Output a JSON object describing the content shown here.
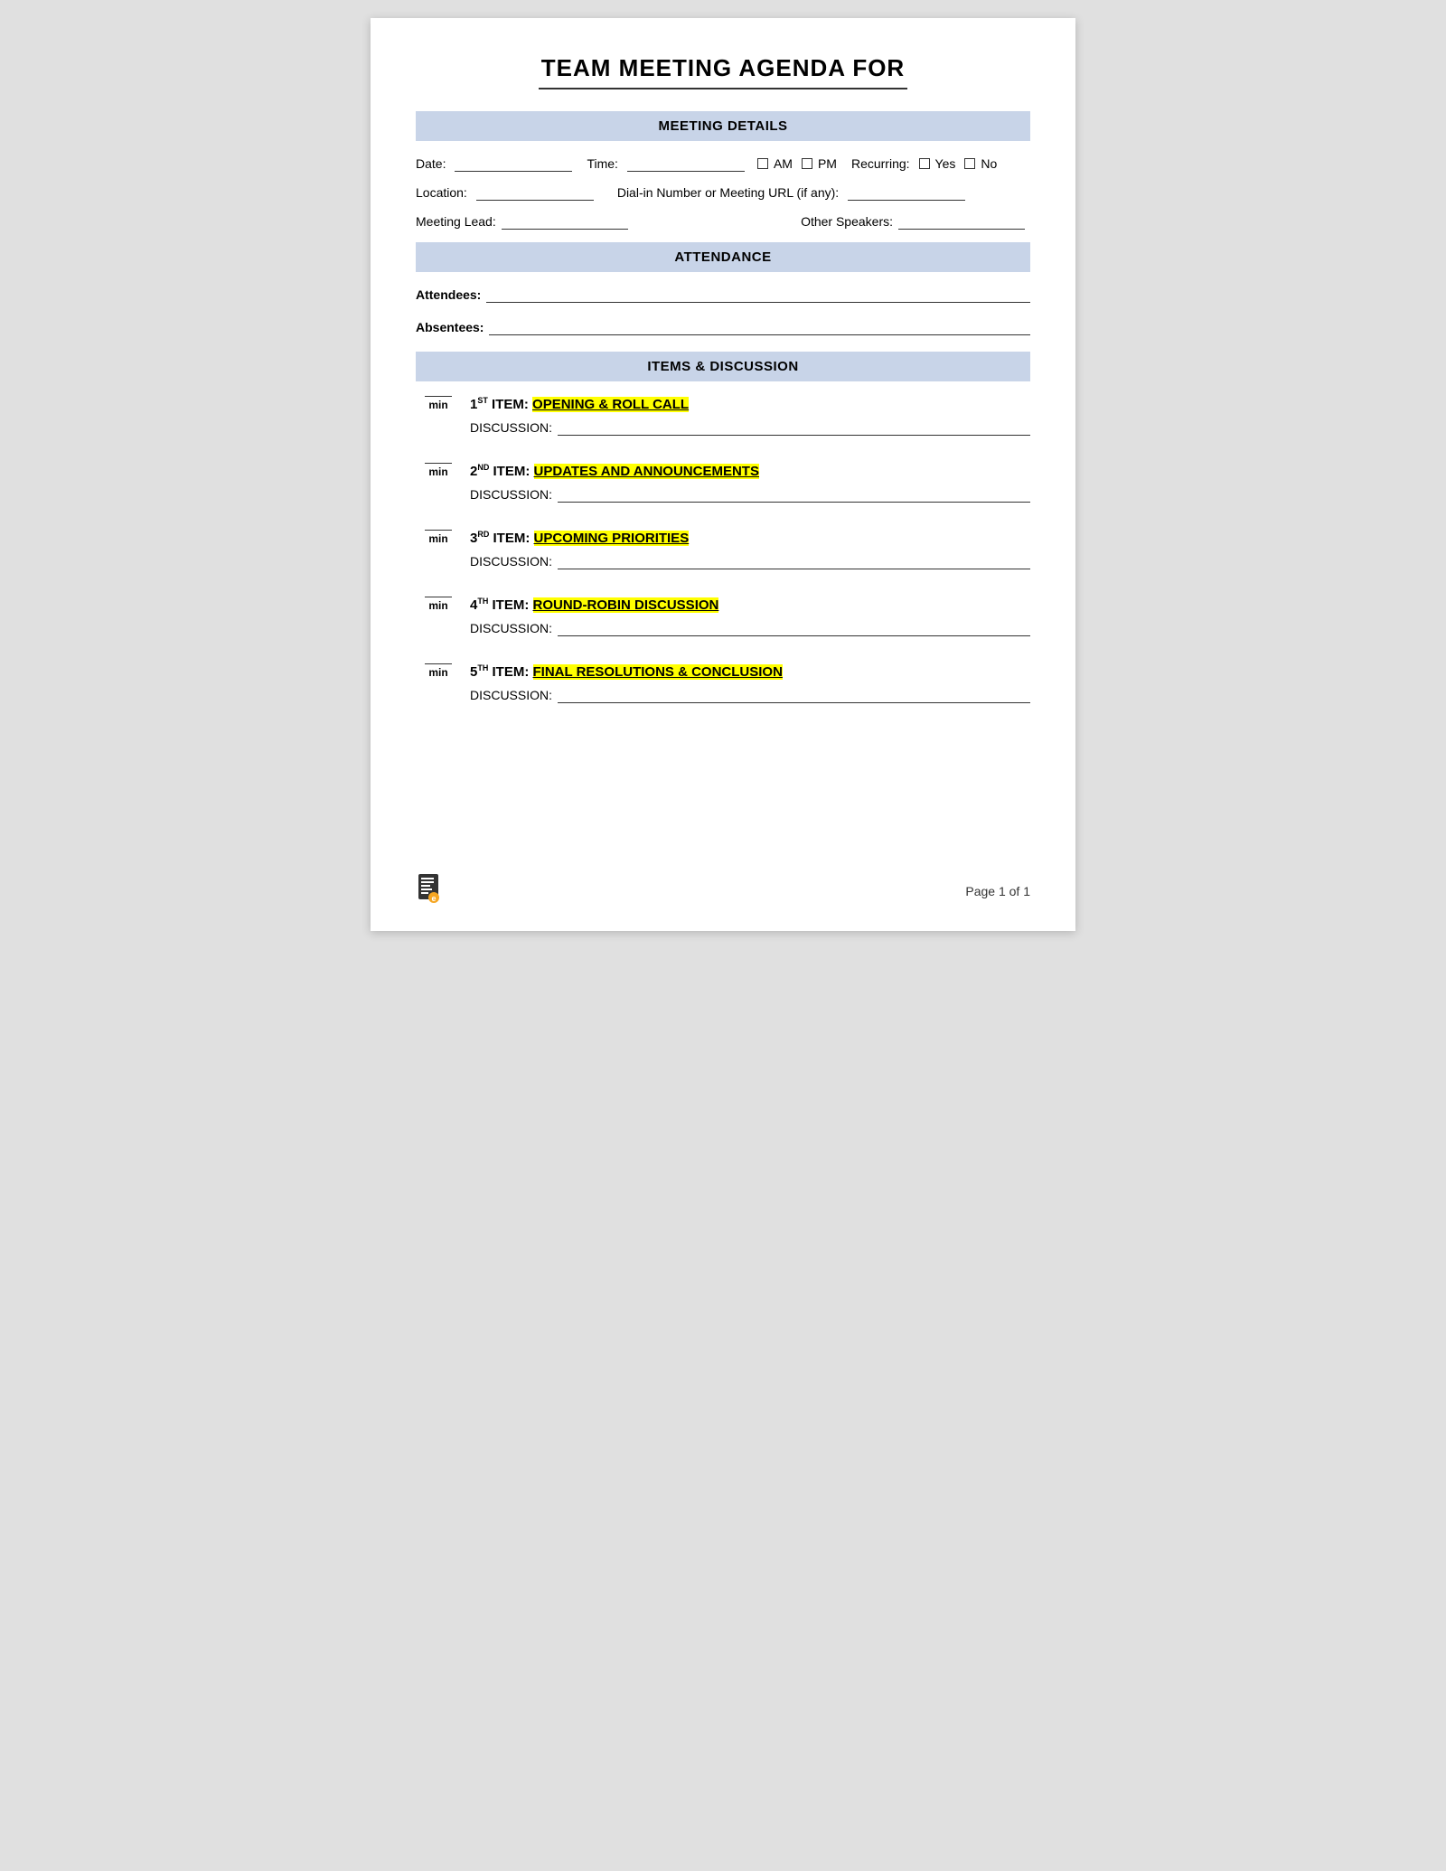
{
  "title": "TEAM MEETING AGENDA FOR",
  "sections": {
    "meeting_details": {
      "header": "MEETING DETAILS",
      "date_label": "Date:",
      "time_label": "Time:",
      "am_label": "AM",
      "pm_label": "PM",
      "recurring_label": "Recurring:",
      "yes_label": "Yes",
      "no_label": "No",
      "location_label": "Location:",
      "dialin_label": "Dial-in Number or Meeting URL (if any):",
      "meeting_lead_label": "Meeting Lead:",
      "other_speakers_label": "Other Speakers:"
    },
    "attendance": {
      "header": "ATTENDANCE",
      "attendees_label": "Attendees:",
      "absentees_label": "Absentees:"
    },
    "items": {
      "header": "ITEMS & DISCUSSION",
      "items_list": [
        {
          "number": "1",
          "ordinal": "ST",
          "title": "OPENING & ROLL CALL",
          "discussion_label": "DISCUSSION:"
        },
        {
          "number": "2",
          "ordinal": "ND",
          "title": "UPDATES AND ANNOUNCEMENTS",
          "discussion_label": "DISCUSSION:"
        },
        {
          "number": "3",
          "ordinal": "RD",
          "title": "UPCOMING PRIORITIES",
          "discussion_label": "DISCUSSION:"
        },
        {
          "number": "4",
          "ordinal": "TH",
          "title": "ROUND-ROBIN DISCUSSION",
          "discussion_label": "DISCUSSION:"
        },
        {
          "number": "5",
          "ordinal": "TH",
          "title": "FINAL RESOLUTIONS & CONCLUSION",
          "discussion_label": "DISCUSSION:"
        }
      ],
      "min_label": "min"
    }
  },
  "footer": {
    "page_label": "Page 1 of 1"
  }
}
